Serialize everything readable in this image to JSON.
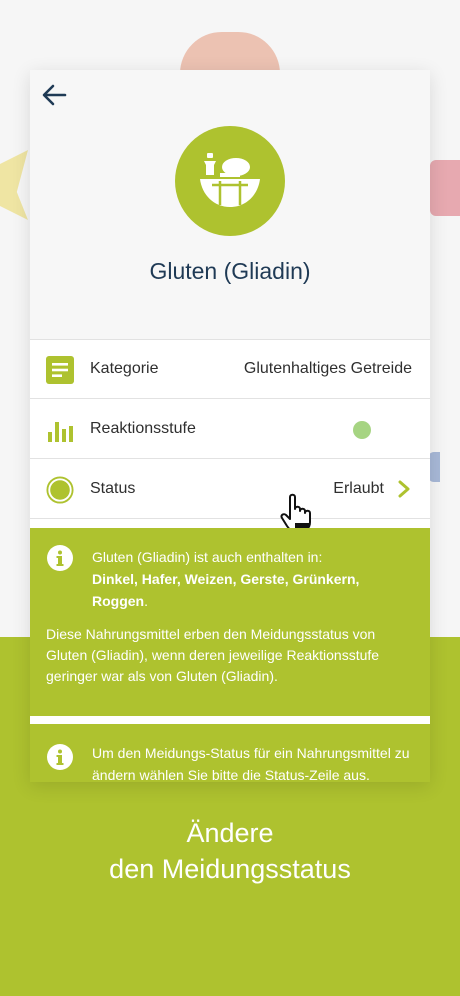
{
  "header": {
    "back_icon": "arrow-left-icon",
    "hero_icon": "bread-basket-icon",
    "title": "Gluten (Gliadin)"
  },
  "rows": {
    "kategorie": {
      "label": "Kategorie",
      "value": "Glutenhaltiges Getreide",
      "icon": "list-icon"
    },
    "reaktion": {
      "label": "Reaktionsstufe",
      "icon": "bar-chart-icon",
      "level_color": "#a6d482"
    },
    "status": {
      "label": "Status",
      "value": "Erlaubt",
      "icon": "circle-status-icon"
    }
  },
  "info1": {
    "line1": "Gluten (Gliadin) ist auch enthalten in:",
    "foods": "Dinkel, Hafer, Weizen, Gerste, Grünkern, Roggen",
    "period": ".",
    "paragraph": "Diese Nahrungsmittel erben den Meidungsstatus von Gluten (Gliadin), wenn deren jeweilige Reaktionsstufe geringer war als von Gluten (Gliadin)."
  },
  "info2": {
    "text": "Um den Meidungs-Status für ein Nahrungsmittel zu ändern wählen Sie bitte die Status-Zeile aus."
  },
  "promo": {
    "line1": "Ändere",
    "line2": "den Meidungsstatus"
  },
  "colors": {
    "accent": "#aec22f",
    "title": "#1f3a55",
    "level_green": "#a6d482"
  }
}
